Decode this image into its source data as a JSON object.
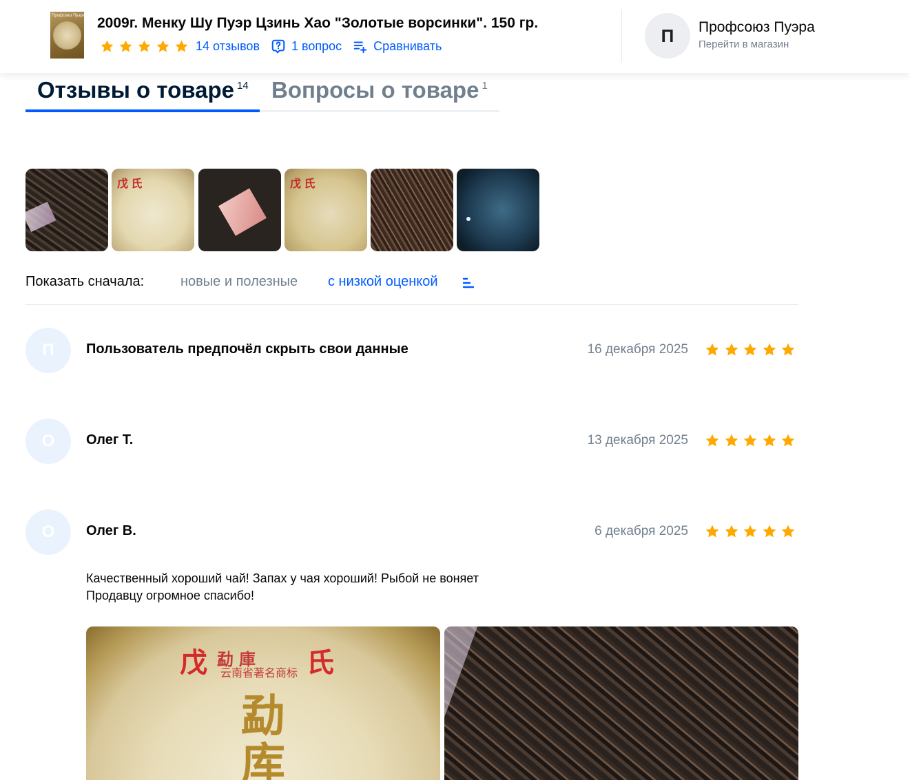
{
  "header": {
    "thumb_text": "Профсоюз Пуэра",
    "product_title": "2009г. Менку Шу Пуэр Цзинь Хао \"Золотые ворсинки\". 150 гр.",
    "rating_stars": 5,
    "reviews_link": "14 отзывов",
    "questions_link": "1 вопрос",
    "compare_link": "Сравнивать",
    "store_initial": "П",
    "store_name": "Профсоюз Пуэра",
    "store_link": "Перейти в магазин"
  },
  "tabs": [
    {
      "label": "Отзывы о товаре",
      "count": "14",
      "active": true
    },
    {
      "label": "Вопросы о товаре",
      "count": "1",
      "active": false
    }
  ],
  "photos": [
    {
      "icon": "tea-leaves-photo"
    },
    {
      "icon": "tea-cake-wrapper-photo",
      "label": "戊 氏"
    },
    {
      "icon": "tea-leaves-wrapper-photo"
    },
    {
      "icon": "tea-cake-photo",
      "label": "戊 氏"
    },
    {
      "icon": "tea-leaves-photo"
    },
    {
      "icon": "tea-cup-photo"
    }
  ],
  "sort": {
    "label": "Показать сначала:",
    "option_helpful": "новые и полезные",
    "option_low": "с низкой оценкой"
  },
  "reviews": [
    {
      "initial": "П",
      "author": "Пользователь предпочёл скрыть свои данные",
      "date": "16 декабря 2025",
      "rating": 5
    },
    {
      "initial": "О",
      "author": "Олег Т.",
      "date": "13 декабря 2025",
      "rating": 5
    },
    {
      "initial": "О",
      "author": "Олег В.",
      "date": "6 декабря 2025",
      "rating": 5,
      "text_line1": "Качественный хороший чай! Запах у чая хороший! Рыбой не воняет",
      "text_line2": "Продавцу огромное спасибо!",
      "photo1_chars": {
        "top": "勐庫",
        "sub": "云南省著名商标",
        "big": "勐\n库",
        "left": "戊",
        "right": "氏"
      }
    }
  ],
  "colors": {
    "accent": "#005bff",
    "star": "#ffa800",
    "muted": "#707f8d"
  }
}
